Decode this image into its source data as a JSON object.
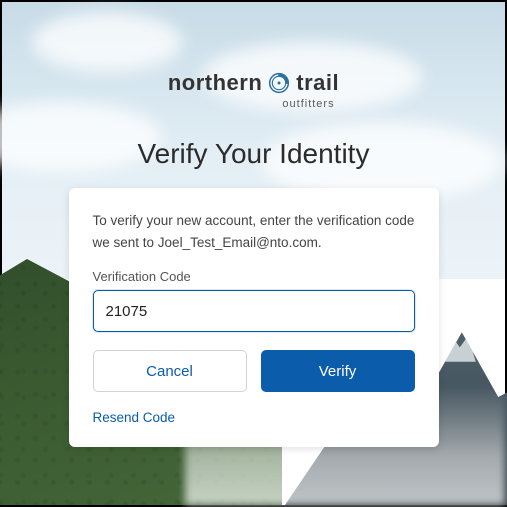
{
  "brand": {
    "name_left": "northern",
    "name_right": "trail",
    "sub": "outfitters",
    "icon": "compass-icon",
    "accent": "#0b5cab"
  },
  "title": "Verify Your Identity",
  "instruction": {
    "prefix": "To verify your new account, enter the verification code we sent to ",
    "email": "Joel_Test_Email@nto.com",
    "suffix": "."
  },
  "field": {
    "label": "Verification Code",
    "value": "21075"
  },
  "buttons": {
    "cancel": "Cancel",
    "verify": "Verify"
  },
  "resend": "Resend Code"
}
